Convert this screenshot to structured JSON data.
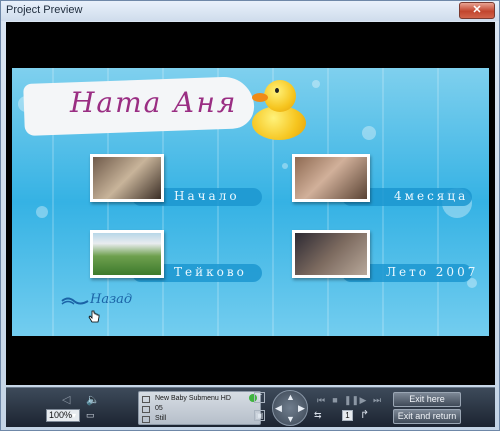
{
  "window": {
    "title": "Project Preview",
    "close_glyph": "✕"
  },
  "menu": {
    "title": "Ната Аня",
    "items": [
      {
        "label": "Начало"
      },
      {
        "label": "4месяца"
      },
      {
        "label": "Тейково"
      },
      {
        "label": "Лето 2007"
      }
    ],
    "back_label": "Назад"
  },
  "controls": {
    "zoom_value": "100%",
    "info": {
      "menu_name": "New Baby Submenu HD",
      "number": "05",
      "mode": "Still"
    },
    "page_number": "1",
    "exit_here_label": "Exit here",
    "exit_and_return_label": "Exit and return"
  },
  "colors": {
    "menu_background": "#35b2e4",
    "title_text": "#9a2e83",
    "back_text": "#1b63a6"
  }
}
